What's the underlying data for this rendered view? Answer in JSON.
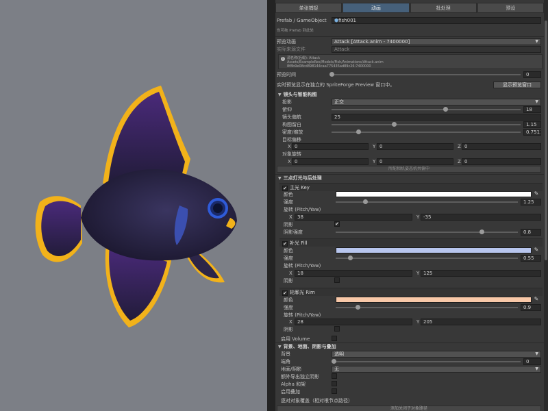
{
  "tabs": [
    "单张捕捉",
    "动画",
    "批处理",
    "预设"
  ],
  "active_tab": 1,
  "prefab": {
    "label": "Prefab / GameObject",
    "value": "fish001",
    "hint": "也可拖 Prefab 到此处"
  },
  "anim": {
    "label": "预览动画",
    "value": "Attack  [Attack.anim - 7400000]",
    "source_label": "实际来源文件",
    "source_value": "Attack"
  },
  "info_lines": [
    "源名称(后缀): Attack",
    "Assets/ExampleRes/Models/Fish/Animations/Attack.anim",
    "8f8b9e08cd898144caa775435ad89c26:7400000"
  ],
  "preview_time": {
    "label": "预览时间",
    "value": "0"
  },
  "realtime": {
    "label": "实时预览显示在独立的 SpriteForge Preview 窗口中。",
    "button": "显示预览窗口"
  },
  "camera": {
    "title": "镜头与智能构图",
    "projection_label": "投影",
    "projection_value": "正交",
    "pitch_label": "俯仰",
    "pitch_value": "18",
    "yaw_label": "镜头偏航",
    "yaw_value": "25",
    "margin_label": "构图留白",
    "margin_value": "1.15",
    "zoom_label": "密度/缩放",
    "zoom_value": "0.751314",
    "offset_label": "目标偏移",
    "offset": [
      "0",
      "0",
      "0"
    ],
    "rotation_label": "对象旋转",
    "rotation": [
      "0",
      "0",
      "0"
    ],
    "button": "所配相机姿态机共偏中"
  },
  "lighting": {
    "title": "三点灯光与后处理",
    "key": {
      "title": "主光 Key",
      "color_label": "颜色",
      "color": "#ffffff",
      "intensity_label": "强度",
      "intensity": "1.25",
      "rot_label": "旋转 (Pitch/Yaw)",
      "x": "38",
      "y": "-35",
      "shadow_label": "阴影",
      "shadow": true,
      "shadow_strength_label": "阴影强度",
      "shadow_strength": "0.8"
    },
    "fill": {
      "title": "补光 Fill",
      "color_label": "颜色",
      "color": "#b8c6ee",
      "intensity_label": "强度",
      "intensity": "0.55",
      "rot_label": "旋转 (Pitch/Yaw)",
      "x": "18",
      "y": "125",
      "shadow_label": "阴影",
      "shadow": false
    },
    "rim": {
      "title": "轮廓光 Rim",
      "color_label": "颜色",
      "color": "#f8c8a8",
      "intensity_label": "强度",
      "intensity": "0.9",
      "rot_label": "旋转 (Pitch/Yaw)",
      "x": "28",
      "y": "205",
      "shadow_label": "阴影",
      "shadow": false
    },
    "volume_label": "启用 Volume"
  },
  "background": {
    "title": "背景、地面、阴影与叠加",
    "bg_label": "背景",
    "bg_value": "透明",
    "corner_label": "端角",
    "corner_value": "0",
    "ground_label": "地面/阴影",
    "ground_value": "无",
    "extra_shadow_label": "额外导出独立阴影",
    "alpha_label": "Alpha 和架",
    "overlay_label": "启用叠加",
    "mask_title": "逐对对象覆盖（相对根节点路径）",
    "mask_button": "添加关闭子对象路径"
  },
  "axis": {
    "x": "X",
    "y": "Y",
    "z": "Z"
  },
  "colors": {
    "fish_body": "#2c2748",
    "fish_fin_edge": "#f2b21a",
    "eye_ring": "#2f5bd8",
    "viewport": "#7c7f86"
  }
}
